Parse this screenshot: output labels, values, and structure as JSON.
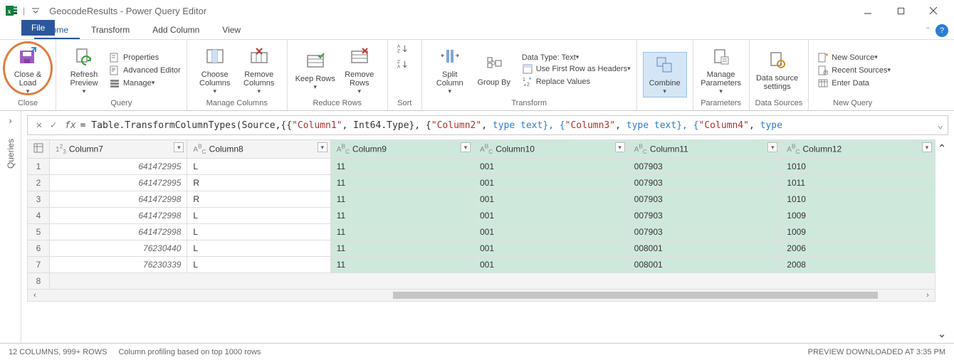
{
  "window": {
    "title": "GeocodeResults - Power Query Editor"
  },
  "tabs": {
    "file": "File",
    "items": [
      "Home",
      "Transform",
      "Add Column",
      "View"
    ],
    "active": "Home"
  },
  "ribbon": {
    "close": {
      "close_load": "Close & Load",
      "group_label": "Close"
    },
    "query": {
      "refresh_preview": "Refresh Preview",
      "properties": "Properties",
      "advanced_editor": "Advanced Editor",
      "manage": "Manage",
      "group_label": "Query"
    },
    "manage_columns": {
      "choose_columns": "Choose Columns",
      "remove_columns": "Remove Columns",
      "group_label": "Manage Columns"
    },
    "reduce_rows": {
      "keep_rows": "Keep Rows",
      "remove_rows": "Remove Rows",
      "group_label": "Reduce Rows"
    },
    "sort": {
      "group_label": "Sort"
    },
    "transform": {
      "split_column": "Split Column",
      "group_by": "Group By",
      "data_type": "Data Type: Text",
      "first_row_headers": "Use First Row as Headers",
      "replace_values": "Replace Values",
      "group_label": "Transform"
    },
    "combine": {
      "combine": "Combine",
      "group_label": ""
    },
    "parameters": {
      "manage_parameters": "Manage Parameters",
      "group_label": "Parameters"
    },
    "data_sources": {
      "data_source_settings": "Data source settings",
      "group_label": "Data Sources"
    },
    "new_query": {
      "new_source": "New Source",
      "recent_sources": "Recent Sources",
      "enter_data": "Enter Data",
      "group_label": "New Query"
    }
  },
  "queries_pane": {
    "label": "Queries"
  },
  "formula_bar": {
    "prefix": "= Table.TransformColumnTypes(Source,{{",
    "parts": [
      {
        "s": "\"Column1\"",
        "t": ", Int64.Type}, {"
      },
      {
        "s": "\"Column2\"",
        "t": ", ",
        "k": "type",
        "t2": " text}, {"
      },
      {
        "s": "\"Column3\"",
        "t": ", ",
        "k": "type",
        "t2": " text}, {"
      },
      {
        "s": "\"Column4\"",
        "t": ", ",
        "k": "type",
        "t2": ""
      }
    ]
  },
  "grid": {
    "columns": [
      {
        "name": "Column7",
        "type": "123"
      },
      {
        "name": "Column8",
        "type": "ABC"
      },
      {
        "name": "Column9",
        "type": "ABC",
        "sel": true
      },
      {
        "name": "Column10",
        "type": "ABC",
        "sel": true
      },
      {
        "name": "Column11",
        "type": "ABC",
        "sel": true
      },
      {
        "name": "Column12",
        "type": "ABC",
        "sel": true
      }
    ],
    "rows": [
      {
        "n": "1",
        "c": [
          "641472995",
          "L",
          "11",
          "001",
          "007903",
          "1010"
        ]
      },
      {
        "n": "2",
        "c": [
          "641472995",
          "R",
          "11",
          "001",
          "007903",
          "1011"
        ]
      },
      {
        "n": "3",
        "c": [
          "641472998",
          "R",
          "11",
          "001",
          "007903",
          "1010"
        ]
      },
      {
        "n": "4",
        "c": [
          "641472998",
          "L",
          "11",
          "001",
          "007903",
          "1009"
        ]
      },
      {
        "n": "5",
        "c": [
          "641472998",
          "L",
          "11",
          "001",
          "007903",
          "1009"
        ]
      },
      {
        "n": "6",
        "c": [
          "76230440",
          "L",
          "11",
          "001",
          "008001",
          "2006"
        ]
      },
      {
        "n": "7",
        "c": [
          "76230339",
          "L",
          "11",
          "001",
          "008001",
          "2008"
        ]
      }
    ],
    "last_row": "8"
  },
  "status": {
    "left1": "12 COLUMNS, 999+ ROWS",
    "left2": "Column profiling based on top 1000 rows",
    "right": "PREVIEW DOWNLOADED AT 3:35 PM"
  }
}
